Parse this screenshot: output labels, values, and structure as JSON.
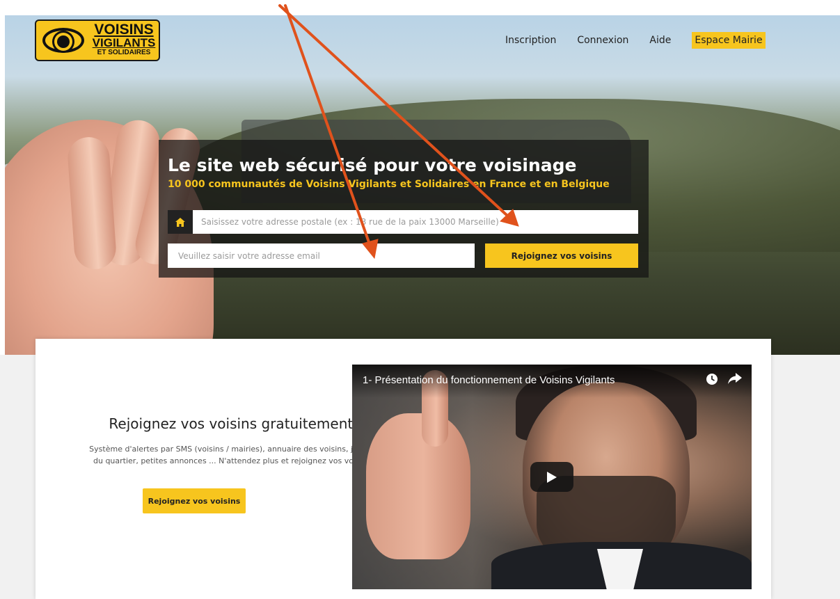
{
  "logo": {
    "line1": "VOISINS",
    "line2": "VIGILANTS",
    "line3": "ET SOLIDAIRES"
  },
  "nav": {
    "items": [
      "Inscription",
      "Connexion",
      "Aide"
    ],
    "highlight": "Espace Mairie"
  },
  "hero": {
    "title": "Le site web sécurisé pour votre voisinage",
    "subtitle": "10 000 communautés de Voisins Vigilants et Solidaires en France et en Belgique",
    "address_placeholder": "Saisissez votre adresse postale (ex : 13 rue de la paix 13000 Marseille)",
    "email_placeholder": "Veuillez saisir votre adresse email",
    "button": "Rejoignez vos voisins"
  },
  "cta": {
    "title": "Rejoignez vos voisins gratuitement.",
    "description": "Système d'alertes par SMS (voisins / mairies), annuaire des voisins, journal du quartier, petites annonces ... N'attendez plus et rejoignez vos voisins.",
    "button": "Rejoignez vos voisins"
  },
  "video": {
    "title": "1- Présentation du fonctionnement de Voisins Vigilants",
    "icons": [
      "clock-icon",
      "share-icon",
      "play-icon"
    ]
  },
  "colors": {
    "accent": "#f7c51e",
    "panel": "#141414",
    "annotation_arrow": "#e0521c"
  }
}
